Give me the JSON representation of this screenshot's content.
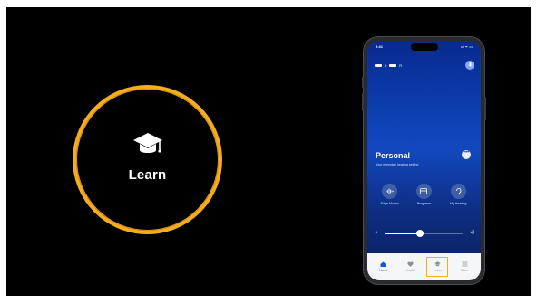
{
  "badge": {
    "label": "Learn",
    "icon": "graduation-cap-icon",
    "ring_color": "#f6ad1c"
  },
  "phone": {
    "status": {
      "time": "9:41",
      "icons": "•ıl ᯤ ▭"
    },
    "battery": {
      "left_level": "L",
      "right_level": "R"
    },
    "program": {
      "title": "Personal",
      "subtitle": "Your everyday hearing setting",
      "more": "•••"
    },
    "actions": [
      {
        "label": "Edge Mode+",
        "icon": "waveform-icon"
      },
      {
        "label": "Programs",
        "icon": "programs-icon"
      },
      {
        "label": "My Hearing",
        "icon": "ear-icon"
      }
    ],
    "volume": {
      "level": 0.45,
      "low_icon": "◂",
      "high_icon": "◂)"
    },
    "tabs": [
      {
        "label": "Home",
        "icon": "home-icon",
        "active": true
      },
      {
        "label": "Health",
        "icon": "heart-icon",
        "active": false
      },
      {
        "label": "Learn",
        "icon": "graduation-cap-icon",
        "active": false,
        "highlighted": true
      },
      {
        "label": "Store",
        "icon": "menu-icon",
        "active": false
      }
    ]
  }
}
